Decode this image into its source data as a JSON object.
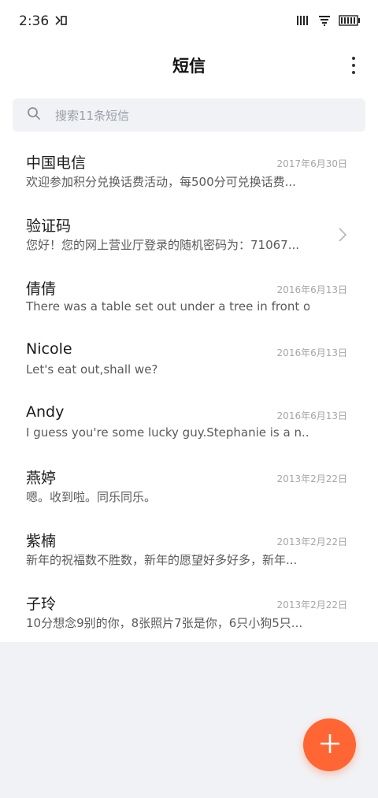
{
  "status_bar": {
    "time": "2:36",
    "icons": [
      "notification-icon",
      "signal-icon",
      "wifi-icon",
      "battery-icon"
    ]
  },
  "header": {
    "title": "短信",
    "more_icon": "more-vertical-icon"
  },
  "search": {
    "placeholder": "搜索11条短信",
    "icon": "search-icon"
  },
  "conversations": [
    {
      "name": "中国电信",
      "date": "2017年6月30日",
      "preview": "欢迎参加积分兑换话费活动，每500分可兑换话费..."
    },
    {
      "name": "验证码",
      "date": "",
      "preview": "您好！您的网上营业厅登录的随机密码为：71067...",
      "has_chevron": true
    },
    {
      "name": "倩倩",
      "date": "2016年6月13日",
      "preview": "There was a table set out under a tree in front o..."
    },
    {
      "name": "Nicole",
      "date": "2016年6月13日",
      "preview": "Let's eat out,shall we?"
    },
    {
      "name": "Andy",
      "date": "2016年6月13日",
      "preview": "I guess you're some lucky guy.Stephanie is a n..."
    },
    {
      "name": "燕婷",
      "date": "2013年2月22日",
      "preview": "嗯。收到啦。同乐同乐。"
    },
    {
      "name": "紫楠",
      "date": "2013年2月22日",
      "preview": "新年的祝福数不胜数，新年的愿望好多好多，新年..."
    },
    {
      "name": "子玲",
      "date": "2013年2月22日",
      "preview": "10分想念9别的你，8张照片7张是你，6只小狗5只..."
    }
  ],
  "fab": {
    "icon": "plus-icon",
    "color": "#ff6633"
  }
}
